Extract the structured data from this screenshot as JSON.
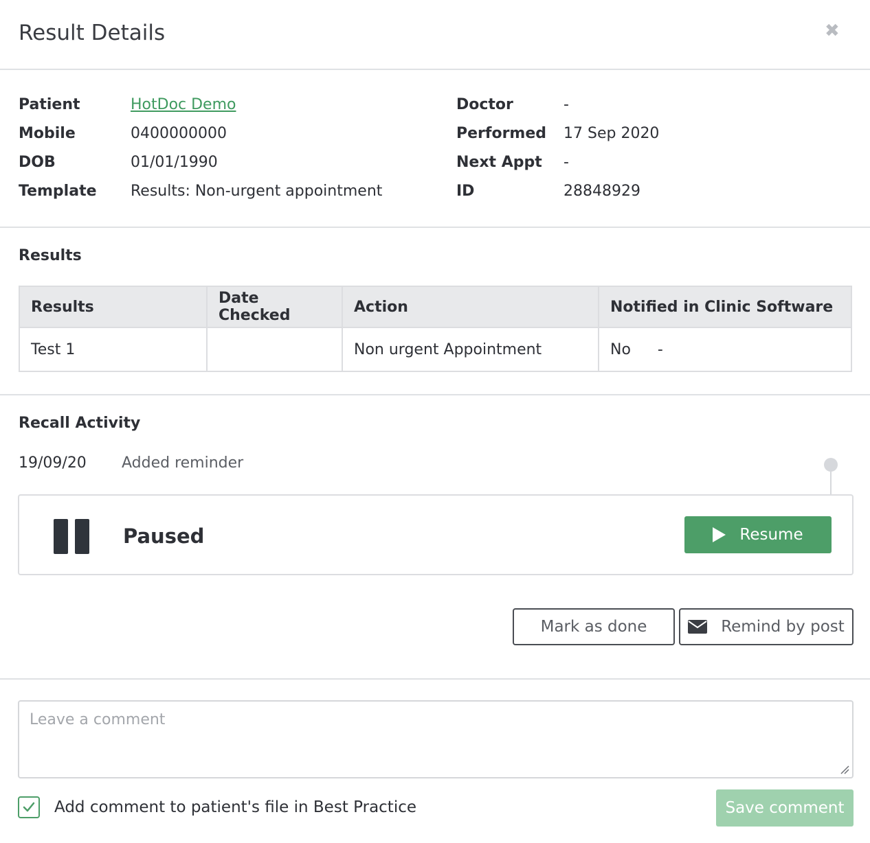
{
  "dialog": {
    "title": "Result Details",
    "close_glyph": "✖"
  },
  "details": {
    "patient_label": "Patient",
    "patient_value": "HotDoc Demo",
    "mobile_label": "Mobile",
    "mobile_value": "0400000000",
    "dob_label": "DOB",
    "dob_value": "01/01/1990",
    "template_label": "Template",
    "template_value": "Results: Non-urgent appointment",
    "doctor_label": "Doctor",
    "doctor_value": "-",
    "performed_label": "Performed",
    "performed_value": "17 Sep 2020",
    "next_appt_label": "Next Appt",
    "next_appt_value": "-",
    "id_label": "ID",
    "id_value": "28848929"
  },
  "results": {
    "section_title": "Results",
    "headers": [
      "Results",
      "Date Checked",
      "Action",
      "Notified in Clinic Software"
    ],
    "rows": [
      {
        "result": "Test 1",
        "date_checked": "",
        "action": "Non urgent Appointment",
        "notified": "No",
        "notified_extra": "-"
      }
    ]
  },
  "recall": {
    "section_title": "Recall Activity",
    "activity": [
      {
        "date": "19/09/20",
        "text": "Added reminder"
      }
    ],
    "status_label": "Paused",
    "status_icon": "pause-icon",
    "resume_label": "Resume",
    "mark_done_label": "Mark as done",
    "remind_post_label": "Remind by post"
  },
  "comment": {
    "placeholder": "Leave a comment",
    "value": "",
    "checkbox_label": "Add comment to patient's file in Best Practice",
    "checkbox_checked": true,
    "save_label": "Save comment"
  },
  "colors": {
    "accent_green": "#4d9e68",
    "link_green": "#3f9a5f",
    "save_disabled_green": "#9fd1ae",
    "divider": "#dfe1e4"
  }
}
